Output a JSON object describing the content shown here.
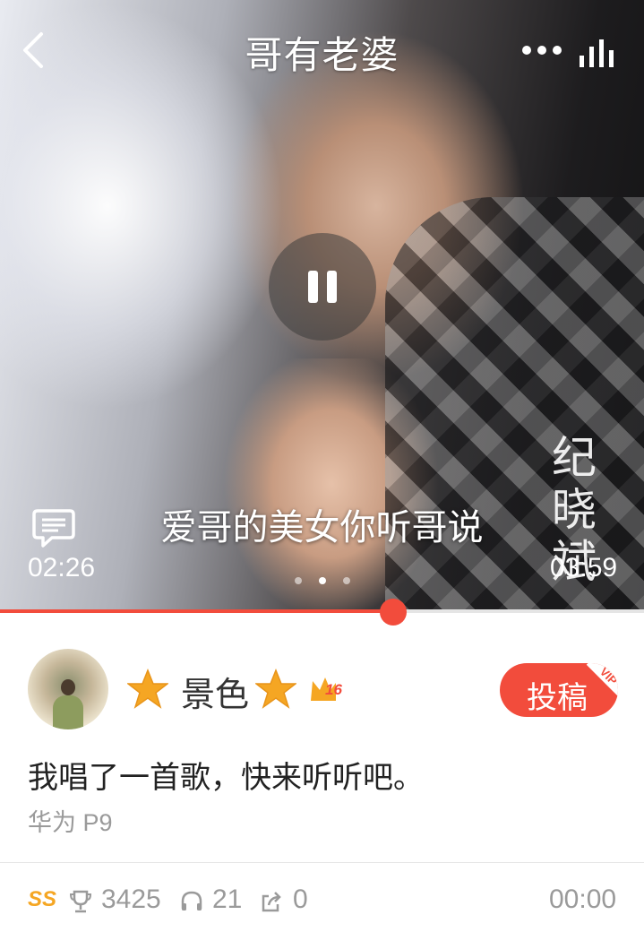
{
  "player": {
    "title": "哥有老婆",
    "lyric": "爱哥的美女你听哥说",
    "watermark": "纪晓斌",
    "current_time": "02:26",
    "total_time": "03:59",
    "progress": 0.61,
    "page_count": 3,
    "active_page": 1
  },
  "user": {
    "name": "景色",
    "level": "16",
    "submit_label": "投稿",
    "vip_tag": "VIP"
  },
  "post": {
    "text": "我唱了一首歌，快来听听吧。",
    "device": "华为 P9"
  },
  "stats": {
    "rank": "SS",
    "trophies": "3425",
    "listens": "21",
    "shares": "0",
    "duration": "00:00"
  },
  "colors": {
    "accent": "#f24c3c",
    "star": "#f5a623",
    "muted": "#9a9a9a"
  },
  "icons": {
    "back": "chevron-left-icon",
    "more": "more-dots-icon",
    "equalizer": "bars-icon",
    "pause": "pause-icon",
    "comment": "comment-icon",
    "trophy": "trophy-icon",
    "headphones": "headphones-icon",
    "share": "share-icon"
  }
}
